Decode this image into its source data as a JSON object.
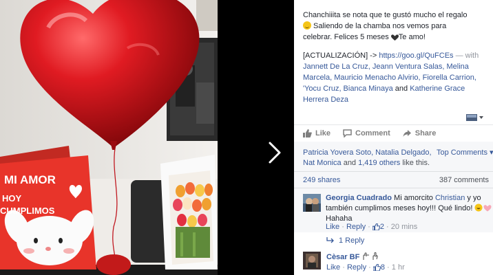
{
  "post": {
    "caption_l1": "Chanchiiita se nota que te gustó mucho el regalo",
    "caption_l2": "Saliendo de la chamba nos vemos para",
    "caption_l3": "celebrar. Felices 5 meses ",
    "caption_l3_end": "Te amo!",
    "update_prefix": "[ACTUALIZACIÓN] -> ",
    "update_link": "https://goo.gl/QuFCEs",
    "update_with": " — with",
    "tagged_line1": "Jannett De La Cruz, Jeann Ventura Salas, Melina",
    "tagged_line2": "Marcela, Mauricio Menacho Alvirio, Fiorella Carrion,",
    "tagged_line3": "'Yocu Cruz, Bianca Minaya",
    "tagged_and": " and ",
    "tagged_last1": "Katherine Grace",
    "tagged_last2": "Herrera Deza"
  },
  "photo": {
    "card_line1": "MI AMOR",
    "card_line2": "HOY",
    "card_line3": "CUMPLIMOS"
  },
  "actions": {
    "like": "Like",
    "comment": "Comment",
    "share": "Share"
  },
  "reactions": {
    "names_line1": "Patricia Yovera Soto, Natalia Delgado,",
    "names_line2_a": "Nat Monica",
    "names_line2_b": " and ",
    "names_line2_c": "1,419 others",
    "names_line2_d": " like this.",
    "top_comments": "Top Comments ▾",
    "shares": "249 shares",
    "comments_count": "387 comments"
  },
  "comments": [
    {
      "author": "Georgia Cuadrado",
      "text_line1": " Mi amorcito ",
      "mention": "Christian",
      "text_line1_end": " y yo",
      "text_line2": "también cumplimos meses hoy!!! Qué lindo!",
      "text_line3": "Hahaha",
      "like": "Like",
      "reply": "Reply",
      "likes": "2",
      "time": "20 mins",
      "replies": "1 Reply"
    },
    {
      "author": "Cèsar BF",
      "like": "Like",
      "reply": "Reply",
      "likes": "8",
      "time": "1 hr"
    }
  ],
  "colors": {
    "link": "#365899",
    "balloon": "#d0141c",
    "card": "#e8342a"
  }
}
